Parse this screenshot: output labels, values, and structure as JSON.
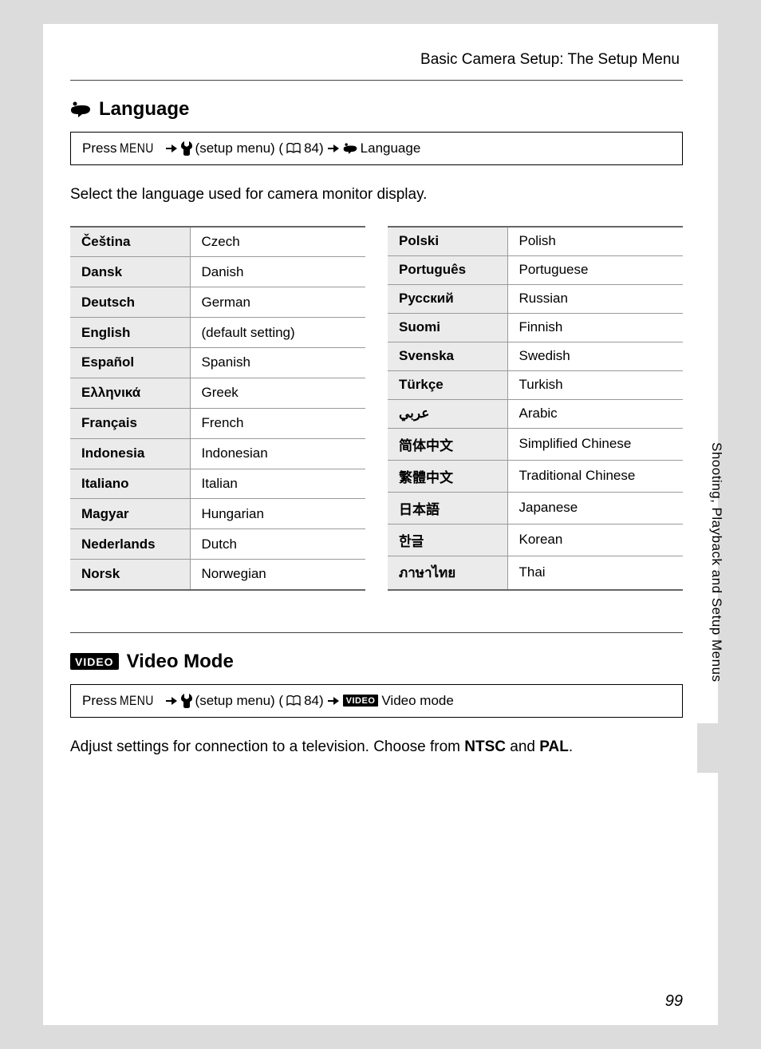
{
  "header": "Basic Camera Setup: The Setup Menu",
  "section_language": {
    "title": "Language",
    "nav": {
      "press": "Press",
      "menu": "MENU",
      "setup": "(setup menu) (",
      "ref": "84)",
      "end": "Language"
    },
    "intro": "Select the language used for camera monitor display.",
    "table_left": [
      {
        "native": "Čeština",
        "desc": "Czech"
      },
      {
        "native": "Dansk",
        "desc": "Danish"
      },
      {
        "native": "Deutsch",
        "desc": "German"
      },
      {
        "native": "English",
        "desc": "(default setting)"
      },
      {
        "native": "Español",
        "desc": "Spanish"
      },
      {
        "native": "Ελληνικά",
        "desc": "Greek"
      },
      {
        "native": "Français",
        "desc": "French"
      },
      {
        "native": "Indonesia",
        "desc": "Indonesian"
      },
      {
        "native": "Italiano",
        "desc": "Italian"
      },
      {
        "native": "Magyar",
        "desc": "Hungarian"
      },
      {
        "native": "Nederlands",
        "desc": "Dutch"
      },
      {
        "native": "Norsk",
        "desc": "Norwegian"
      }
    ],
    "table_right": [
      {
        "native": "Polski",
        "desc": "Polish"
      },
      {
        "native": "Português",
        "desc": "Portuguese"
      },
      {
        "native": "Русский",
        "desc": "Russian"
      },
      {
        "native": "Suomi",
        "desc": "Finnish"
      },
      {
        "native": "Svenska",
        "desc": "Swedish"
      },
      {
        "native": "Türkçe",
        "desc": "Turkish"
      },
      {
        "native": "عربي",
        "desc": "Arabic"
      },
      {
        "native": "简体中文",
        "desc": "Simplified Chinese"
      },
      {
        "native": "繁體中文",
        "desc": "Traditional Chinese"
      },
      {
        "native": "日本語",
        "desc": "Japanese"
      },
      {
        "native": "한글",
        "desc": "Korean"
      },
      {
        "native": "ภาษาไทย",
        "desc": "Thai"
      }
    ]
  },
  "section_video": {
    "icon_label": "VIDEO",
    "title": "Video Mode",
    "nav": {
      "press": "Press",
      "menu": "MENU",
      "setup": "(setup menu) (",
      "ref": "84)",
      "end": "Video mode"
    },
    "desc_prefix": "Adjust settings for connection to a television. Choose from ",
    "opt1": "NTSC",
    "and": " and ",
    "opt2": "PAL",
    "period": "."
  },
  "side_label": "Shooting, Playback and Setup Menus",
  "page_number": "99"
}
